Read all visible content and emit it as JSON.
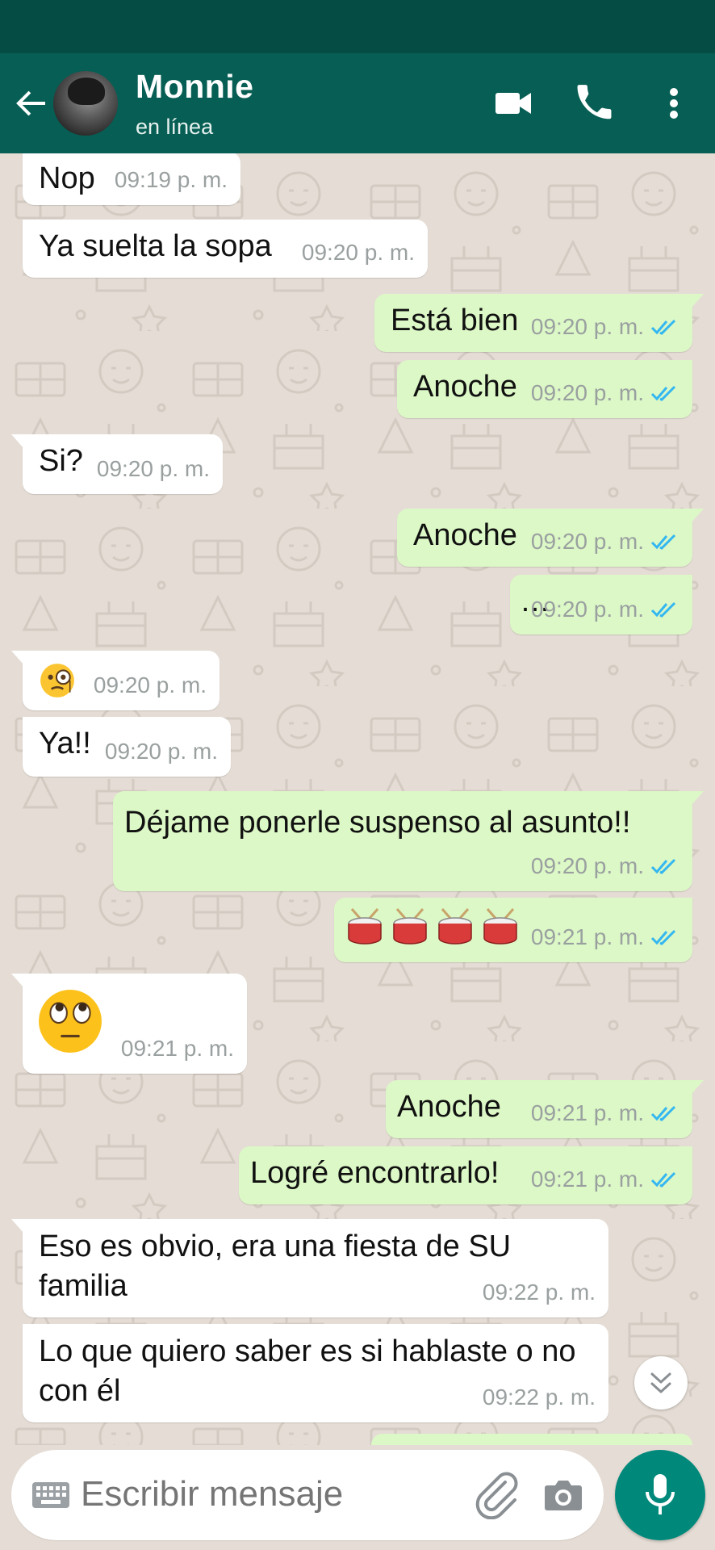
{
  "header": {
    "contact_name": "Monnie",
    "status": "en línea"
  },
  "messages": [
    {
      "dir": "in",
      "text": "Nop",
      "time": "09:19 p. m."
    },
    {
      "dir": "in",
      "text": "Ya suelta la sopa",
      "time": "09:20 p. m."
    },
    {
      "dir": "out",
      "text": "Está bien",
      "time": "09:20 p. m.",
      "status": "read"
    },
    {
      "dir": "out",
      "text": "Anoche",
      "time": "09:20 p. m.",
      "status": "read"
    },
    {
      "dir": "in",
      "text": "Si?",
      "time": "09:20 p. m."
    },
    {
      "dir": "out",
      "text": "Anoche",
      "time": "09:20 p. m.",
      "status": "read"
    },
    {
      "dir": "out",
      "text": "…",
      "time": "09:20 p. m.",
      "status": "read"
    },
    {
      "dir": "in",
      "emoji": "face-with-monocle",
      "time": "09:20 p. m."
    },
    {
      "dir": "in",
      "text": "Ya!!",
      "time": "09:20 p. m."
    },
    {
      "dir": "out",
      "text": "Déjame ponerle suspenso al asunto!!",
      "time": "09:20 p. m.",
      "status": "read"
    },
    {
      "dir": "out",
      "emoji": "drum x4",
      "time": "09:21 p. m.",
      "status": "read"
    },
    {
      "dir": "in",
      "emoji": "face-with-rolling-eyes",
      "time": "09:21 p. m."
    },
    {
      "dir": "out",
      "text": "Anoche",
      "time": "09:21 p. m.",
      "status": "read"
    },
    {
      "dir": "out",
      "text": "Logré encontrarlo!",
      "time": "09:21 p. m.",
      "status": "read"
    },
    {
      "dir": "in",
      "text": "Eso es obvio, era una fiesta de SU familia",
      "time": "09:22 p. m."
    },
    {
      "dir": "in",
      "text": "Lo que quiero saber es si hablaste o no con él",
      "time": "09:22 p. m."
    }
  ],
  "composer": {
    "placeholder": "Escribir mensaje"
  },
  "icons": {
    "back": "arrow-back-icon",
    "video": "videocam-icon",
    "call": "phone-icon",
    "menu": "more-vert-icon",
    "keyboard": "keyboard-icon",
    "attach": "paperclip-icon",
    "camera": "camera-icon",
    "mic": "mic-icon",
    "scroll_down": "double-chevron-down-icon"
  },
  "colors": {
    "header": "#075e54",
    "status_bar": "#054d44",
    "outgoing_bubble": "#dcf8c6",
    "incoming_bubble": "#ffffff",
    "read_ticks": "#34b7f1",
    "fab": "#00897b"
  }
}
